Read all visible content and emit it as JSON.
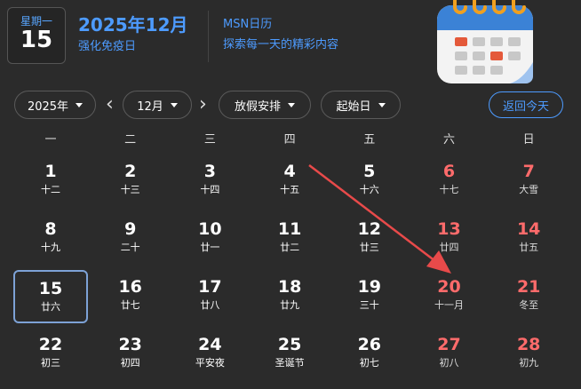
{
  "header": {
    "weekday": "星期一",
    "day": "15",
    "date_title": "2025年12月",
    "festival": "强化免疫日",
    "msn_title": "MSN日历",
    "msn_subtitle": "探索每一天的精彩内容"
  },
  "controls": {
    "year": "2025年",
    "month": "12月",
    "holiday": "放假安排",
    "start_day": "起始日",
    "today": "返回今天"
  },
  "weekdays": [
    "一",
    "二",
    "三",
    "四",
    "五",
    "六",
    "日"
  ],
  "weeks": [
    [
      [
        "1",
        "十二"
      ],
      [
        "2",
        "十三"
      ],
      [
        "3",
        "十四"
      ],
      [
        "4",
        "十五"
      ],
      [
        "5",
        "十六"
      ],
      [
        "6",
        "十七"
      ],
      [
        "7",
        "大雪"
      ]
    ],
    [
      [
        "8",
        "十九"
      ],
      [
        "9",
        "二十"
      ],
      [
        "10",
        "廿一"
      ],
      [
        "11",
        "廿二"
      ],
      [
        "12",
        "廿三"
      ],
      [
        "13",
        "廿四"
      ],
      [
        "14",
        "廿五"
      ]
    ],
    [
      [
        "15",
        "廿六"
      ],
      [
        "16",
        "廿七"
      ],
      [
        "17",
        "廿八"
      ],
      [
        "18",
        "廿九"
      ],
      [
        "19",
        "三十"
      ],
      [
        "20",
        "十一月"
      ],
      [
        "21",
        "冬至"
      ]
    ],
    [
      [
        "22",
        "初三"
      ],
      [
        "23",
        "初四"
      ],
      [
        "24",
        "平安夜"
      ],
      [
        "25",
        "圣诞节"
      ],
      [
        "26",
        "初七"
      ],
      [
        "27",
        "初八"
      ],
      [
        "28",
        "初九"
      ]
    ]
  ],
  "colors": {
    "accent": "#4d9bff",
    "weekend": "#ff6b6b",
    "today_border": "#7da2d6",
    "annotation_arrow": "#e84a4a"
  },
  "icons": {
    "calendar": "calendar-icon",
    "prev": "chevron-left-icon",
    "next": "chevron-right-icon",
    "dropdown": "caret-down-icon"
  }
}
